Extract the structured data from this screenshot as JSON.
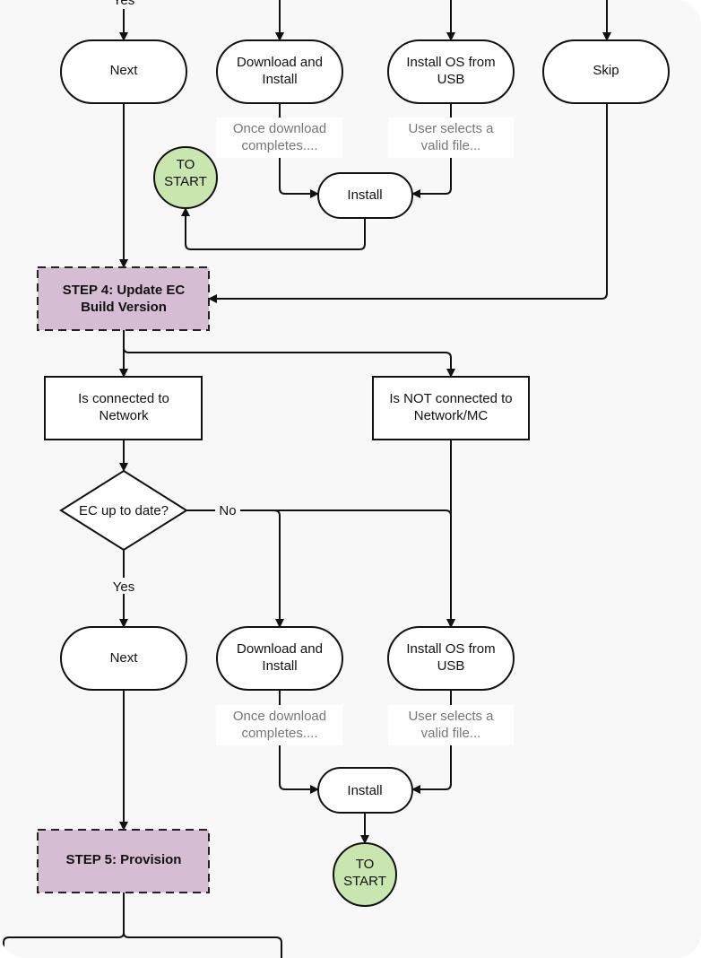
{
  "colors": {
    "step_fill": "#d5bdd4",
    "start_fill": "#c8e6ae",
    "note_text": "#777777",
    "background": "#f8f8f8"
  },
  "top": {
    "yes_label": "Yes",
    "next": "Next",
    "download": [
      "Download and",
      "Install"
    ],
    "install_usb": [
      "Install OS from",
      "USB"
    ],
    "skip": "Skip",
    "note_download": [
      "Once download",
      "completes...."
    ],
    "note_usb": [
      "User selects a",
      "valid file..."
    ],
    "install": "Install",
    "to_start": [
      "TO",
      "START"
    ]
  },
  "step4": [
    "STEP 4: Update EC",
    "Build Version"
  ],
  "connected": [
    "Is connected to",
    "Network"
  ],
  "not_connected": [
    "Is NOT connected to",
    "Network/MC"
  ],
  "decision": {
    "label": "EC up to date?",
    "no": "No",
    "yes": "Yes"
  },
  "bottom": {
    "next": "Next",
    "download": [
      "Download and",
      "Install"
    ],
    "install_usb": [
      "Install OS from",
      "USB"
    ],
    "note_download": [
      "Once download",
      "completes...."
    ],
    "note_usb": [
      "User selects a",
      "valid file..."
    ],
    "install": "Install",
    "to_start": [
      "TO",
      "START"
    ]
  },
  "step5": "STEP 5: Provision"
}
